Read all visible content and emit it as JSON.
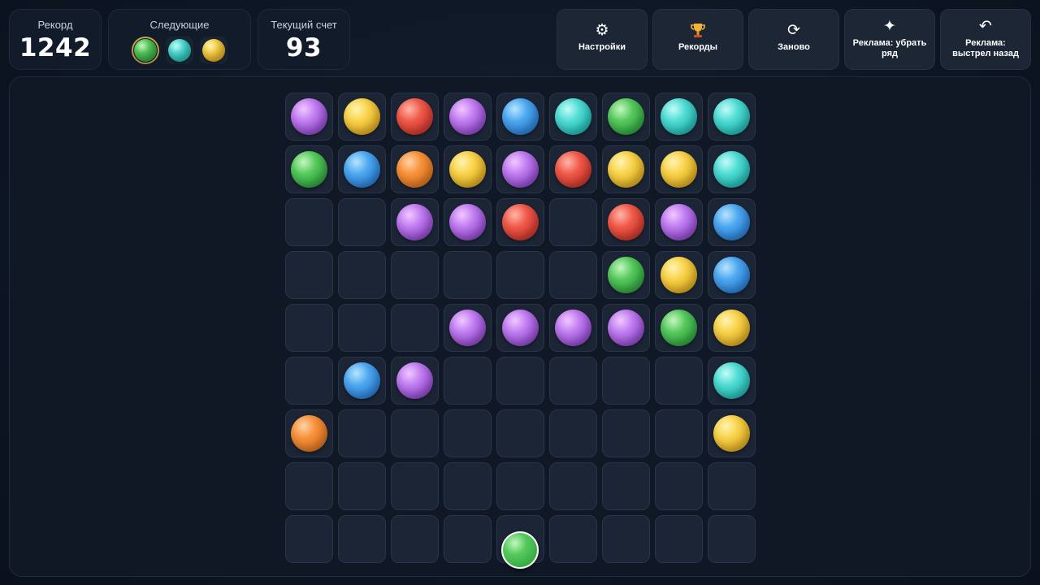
{
  "header": {
    "record": {
      "label": "Рекорд",
      "value": "1242"
    },
    "next": {
      "label": "Следующие",
      "balls": [
        "green",
        "cyan",
        "yellow"
      ]
    },
    "score": {
      "label": "Текущий счет",
      "value": "93"
    }
  },
  "toolbar": {
    "settings": {
      "label": "Настройки",
      "icon": "gear-icon"
    },
    "records": {
      "label": "Рекорды",
      "icon": "trophy-icon"
    },
    "restart": {
      "label": "Заново",
      "icon": "restart-icon"
    },
    "ad_remove_row": {
      "label": "Реклама: убрать ряд",
      "icon": "sparkle-icon"
    },
    "ad_undo_shot": {
      "label": "Реклама: выстрел назад",
      "icon": "undo-icon"
    }
  },
  "colors": {
    "purple": "#b06ae8",
    "yellow": "#f2c43a",
    "red": "#e54a3c",
    "blue": "#3b96ea",
    "cyan": "#3ad0c8",
    "green": "#45bb50",
    "orange": "#f0852e"
  },
  "board": {
    "rows": 9,
    "cols": 9,
    "cells": [
      [
        "purple",
        "yellow",
        "red",
        "purple",
        "blue",
        "cyan",
        "green",
        "cyan",
        "cyan"
      ],
      [
        "green",
        "blue",
        "orange",
        "yellow",
        "purple",
        "red",
        "yellow",
        "yellow",
        "cyan"
      ],
      [
        "",
        "",
        "purple",
        "purple",
        "red",
        "",
        "red",
        "purple",
        "blue"
      ],
      [
        "",
        "",
        "",
        "",
        "",
        "",
        "green",
        "yellow",
        "blue"
      ],
      [
        "",
        "",
        "",
        "purple",
        "purple",
        "purple",
        "purple",
        "green",
        "yellow"
      ],
      [
        "",
        "blue",
        "purple",
        "",
        "",
        "",
        "",
        "",
        "cyan"
      ],
      [
        "orange",
        "",
        "",
        "",
        "",
        "",
        "",
        "",
        "yellow"
      ],
      [
        "",
        "",
        "",
        "",
        "",
        "",
        "",
        "",
        ""
      ],
      [
        "",
        "",
        "",
        "",
        "",
        "",
        "",
        "",
        ""
      ]
    ]
  },
  "shooter": {
    "color": "green",
    "column": 5
  }
}
